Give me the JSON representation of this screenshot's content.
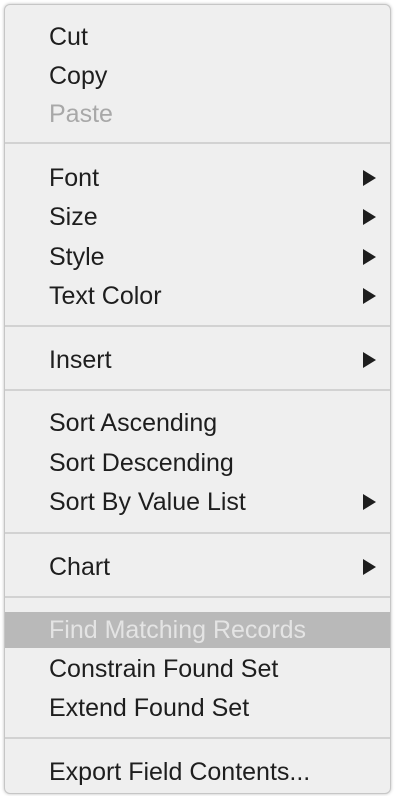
{
  "menu": {
    "cut": "Cut",
    "copy": "Copy",
    "paste": "Paste",
    "font": "Font",
    "size": "Size",
    "style": "Style",
    "text_color": "Text Color",
    "insert": "Insert",
    "sort_ascending": "Sort Ascending",
    "sort_descending": "Sort Descending",
    "sort_by_value_list": "Sort By Value List",
    "chart": "Chart",
    "find_matching_records": "Find Matching Records",
    "constrain_found_set": "Constrain Found Set",
    "extend_found_set": "Extend Found Set",
    "export_field_contents": "Export Field Contents..."
  },
  "icons": {
    "submenu": "submenu-arrow-icon"
  },
  "colors": {
    "menu_background": "#efefef",
    "text": "#1e1e1e",
    "disabled_text": "#a8a8a8",
    "highlight_background": "#b9b9b9",
    "highlight_text": "#e4e4e4",
    "separator": "#d2d2d2"
  }
}
